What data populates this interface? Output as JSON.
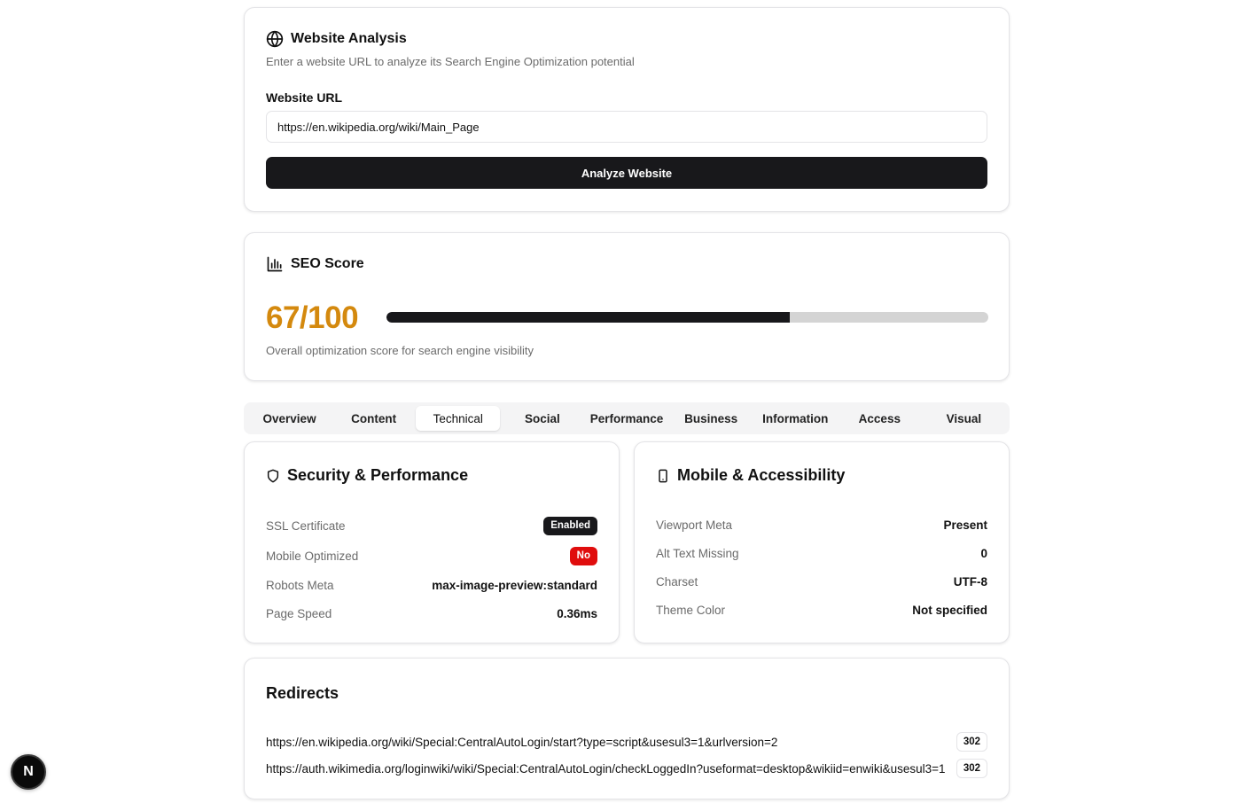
{
  "analysis": {
    "title": "Website Analysis",
    "icon": "globe-icon",
    "description": "Enter a website URL to analyze its Search Engine Optimization potential",
    "url_label": "Website URL",
    "url_value": "https://en.wikipedia.org/wiki/Main_Page",
    "button_label": "Analyze Website"
  },
  "score": {
    "title": "SEO Score",
    "icon": "bar-chart-icon",
    "value_text": "67/100",
    "progress_percent": 67,
    "description": "Overall optimization score for search engine visibility",
    "value_color": "#d4890e"
  },
  "tabs": [
    {
      "label": "Overview",
      "active": false
    },
    {
      "label": "Content",
      "active": false
    },
    {
      "label": "Technical",
      "active": true
    },
    {
      "label": "Social",
      "active": false
    },
    {
      "label": "Performance",
      "active": false
    },
    {
      "label": "Business",
      "active": false
    },
    {
      "label": "Information",
      "active": false
    },
    {
      "label": "Access",
      "active": false
    },
    {
      "label": "Visual",
      "active": false
    }
  ],
  "security": {
    "title": "Security & Performance",
    "icon": "shield-icon",
    "rows": [
      {
        "key": "SSL Certificate",
        "value": "Enabled",
        "style": "badge-dark"
      },
      {
        "key": "Mobile Optimized",
        "value": "No",
        "style": "badge-red"
      },
      {
        "key": "Robots Meta",
        "value": "max-image-preview:standard",
        "style": "text"
      },
      {
        "key": "Page Speed",
        "value": "0.36ms",
        "style": "text"
      }
    ]
  },
  "mobile": {
    "title": "Mobile & Accessibility",
    "icon": "smartphone-icon",
    "rows": [
      {
        "key": "Viewport Meta",
        "value": "Present"
      },
      {
        "key": "Alt Text Missing",
        "value": "0"
      },
      {
        "key": "Charset",
        "value": "UTF-8"
      },
      {
        "key": "Theme Color",
        "value": "Not specified"
      }
    ]
  },
  "redirects": {
    "title": "Redirects",
    "items": [
      {
        "url": "https://en.wikipedia.org/wiki/Special:CentralAutoLogin/start?type=script&usesul3=1&urlversion=2",
        "code": "302"
      },
      {
        "url": "https://auth.wikimedia.org/loginwiki/wiki/Special:CentralAutoLogin/checkLoggedIn?useformat=desktop&wikiid=enwiki&usesul3=1",
        "code": "302"
      }
    ]
  },
  "floating_badge": {
    "label": "N"
  }
}
